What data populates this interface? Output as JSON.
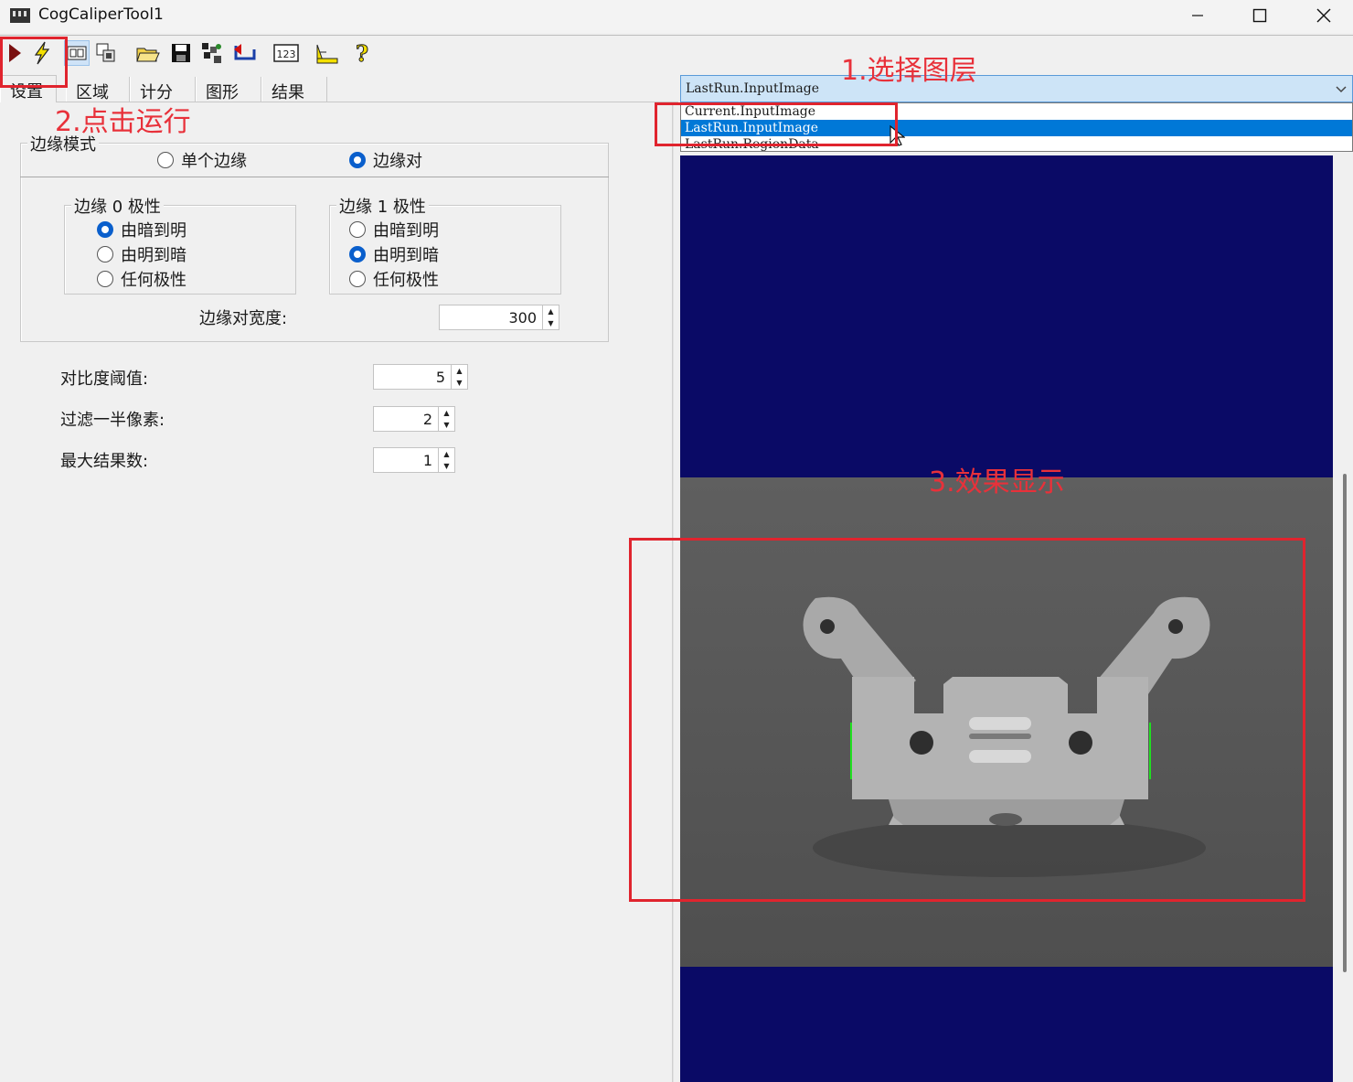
{
  "window": {
    "title": "CogCaliperTool1"
  },
  "tabs": [
    {
      "label": "设置"
    },
    {
      "label": "区域"
    },
    {
      "label": "计分"
    },
    {
      "label": "图形"
    },
    {
      "label": "结果"
    }
  ],
  "settings": {
    "edge_mode": {
      "legend": "边缘模式",
      "options": [
        "单个边缘",
        "边缘对"
      ],
      "selected": "边缘对"
    },
    "edge0_polarity": {
      "legend": "边缘 0 极性",
      "options": [
        "由暗到明",
        "由明到暗",
        "任何极性"
      ],
      "selected": "由暗到明"
    },
    "edge1_polarity": {
      "legend": "边缘 1 极性",
      "options": [
        "由暗到明",
        "由明到暗",
        "任何极性"
      ],
      "selected": "由明到暗"
    },
    "edge_pair_width": {
      "label": "边缘对宽度:",
      "value": "300"
    },
    "contrast_threshold": {
      "label": "对比度阈值:",
      "value": "5"
    },
    "filter_half_pixels": {
      "label": "过滤一半像素:",
      "value": "2"
    },
    "max_results": {
      "label": "最大结果数:",
      "value": "1"
    }
  },
  "display": {
    "combo_value": "LastRun.InputImage",
    "options": [
      "Current.InputImage",
      "LastRun.InputImage",
      "LastRun.RegionData"
    ],
    "selected_option": "LastRun.InputImage",
    "background_color": "#0a0a66"
  },
  "annotations": {
    "step1": "1.选择图层",
    "step2": "2.点击运行",
    "step3": "3.效果显示",
    "color": "#e0242e"
  },
  "toolbar_icons": [
    "run-icon",
    "electric-icon",
    "display-icon",
    "copy-icon",
    "open-icon",
    "save-icon",
    "grid-icon",
    "reset-icon",
    "counter-icon",
    "measure-icon",
    "help-icon"
  ]
}
